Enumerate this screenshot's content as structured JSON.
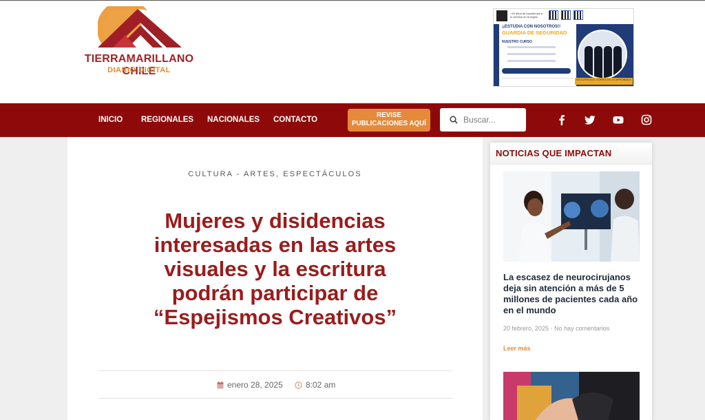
{
  "site": {
    "name": "TIERRAMARILLANO CHILE",
    "tagline": "DIARIO DIGITAL"
  },
  "ad": {
    "top_text": "+15 años de experiencia a tu servicio en la región",
    "headline_1": "¡¡ESTUDIA CON NOSOTROS!!",
    "headline_2": "GUARDIA DE SEGURIDAD",
    "course_label": "NUESTRO CURSO",
    "cta": "¡LLÁMANOS Y CONSULTA POR REQUISITOS Y PRECIOS!",
    "banner": "RECUERDA EL CURSO OS-10 APROBADO"
  },
  "nav": {
    "items": [
      "INICIO",
      "REGIONALES",
      "NACIONALES",
      "CONTACTO"
    ],
    "cta_line1": "REVISE",
    "cta_line2": "PUBLICACIONES AQUÍ",
    "search_placeholder": "Buscar..."
  },
  "social": {
    "icons": [
      "facebook-icon",
      "twitter-icon",
      "youtube-icon",
      "instagram-icon"
    ]
  },
  "article": {
    "category": "CULTURA - ARTES, ESPECTÁCULOS",
    "title": "Mujeres y disidencias interesadas en las artes visuales y la escritura podrán participar de “Espejismos Creativos”",
    "date": "enero 28, 2025",
    "time": "8:02 am"
  },
  "sidebar": {
    "title": "NOTICIAS QUE IMPACTAN",
    "post": {
      "title": "La escasez de neurocirujanos deja sin atención a más de 5 millones de pacientes cada año en el mundo",
      "meta": "20 febrero, 2025 · No hay comentarios",
      "read_more": "Leer más"
    }
  },
  "colors": {
    "brand_red": "#8e0a0a",
    "headline_red": "#9b1c1c",
    "accent_orange": "#e58a3a"
  }
}
